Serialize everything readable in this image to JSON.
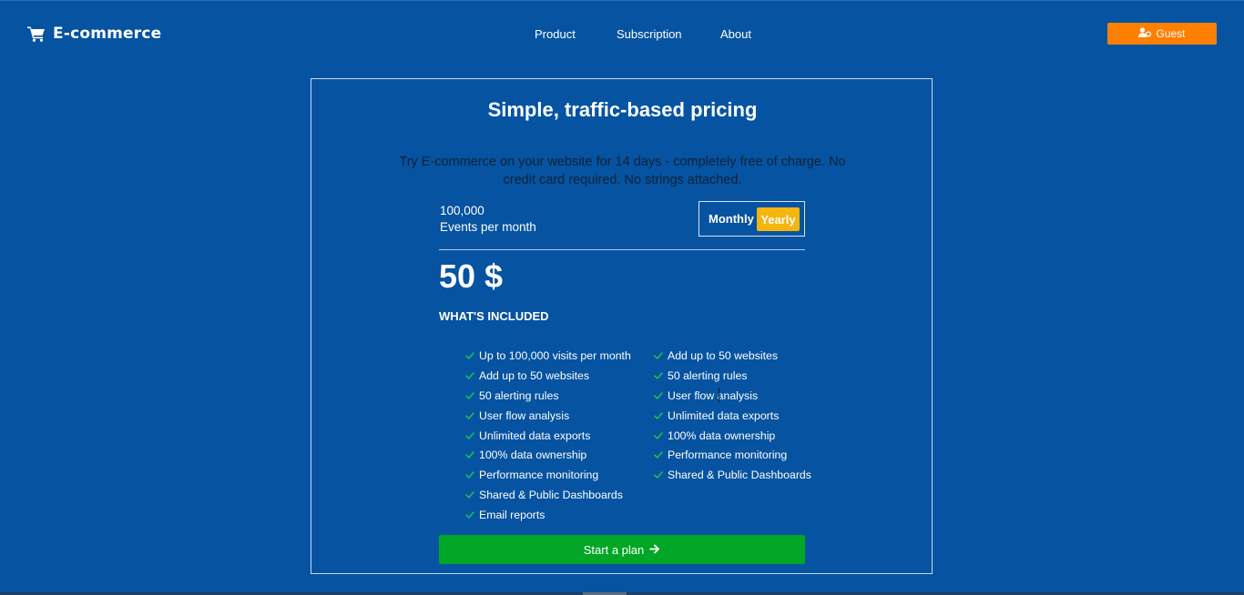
{
  "header": {
    "brand": "E-commerce",
    "nav": [
      "Product",
      "Subscription",
      "About"
    ],
    "guest_label": "Guest"
  },
  "pricing": {
    "title": "Simple, traffic-based pricing",
    "subtitle": "Try E-commerce on your website for 14 days - completely free of charge. No credit card required. No strings attached.",
    "events_count": "100,000",
    "events_label": "Events per month",
    "toggle": {
      "monthly": "Monthly",
      "yearly": "Yearly",
      "selected": "Yearly"
    },
    "price": "50 $",
    "included_heading": "WHAT'S INCLUDED",
    "features_left": [
      "Up to 100,000 visits per month",
      "Add up to 50 websites",
      "50 alerting rules",
      "User flow analysis",
      "Unlimited data exports",
      "100% data ownership",
      "Performance monitoring",
      "Shared & Public Dashboards",
      "Email reports"
    ],
    "features_right": [
      "Add up to 50 websites",
      "50 alerting rules",
      "User flow analysis",
      "Unlimited data exports",
      "100% data ownership",
      "Performance monitoring",
      "Shared & Public Dashboards"
    ],
    "cta_label": "Start a plan"
  },
  "colors": {
    "background": "#0653a1",
    "guest_button": "#ff7f00",
    "yearly_toggle": "#f6b40e",
    "cta_button": "#02a626",
    "check": "#1fc34a"
  },
  "icons": {
    "brand": "cart-icon",
    "guest": "user-cog-icon",
    "cta": "arrow-right-icon",
    "feature": "check-icon"
  }
}
